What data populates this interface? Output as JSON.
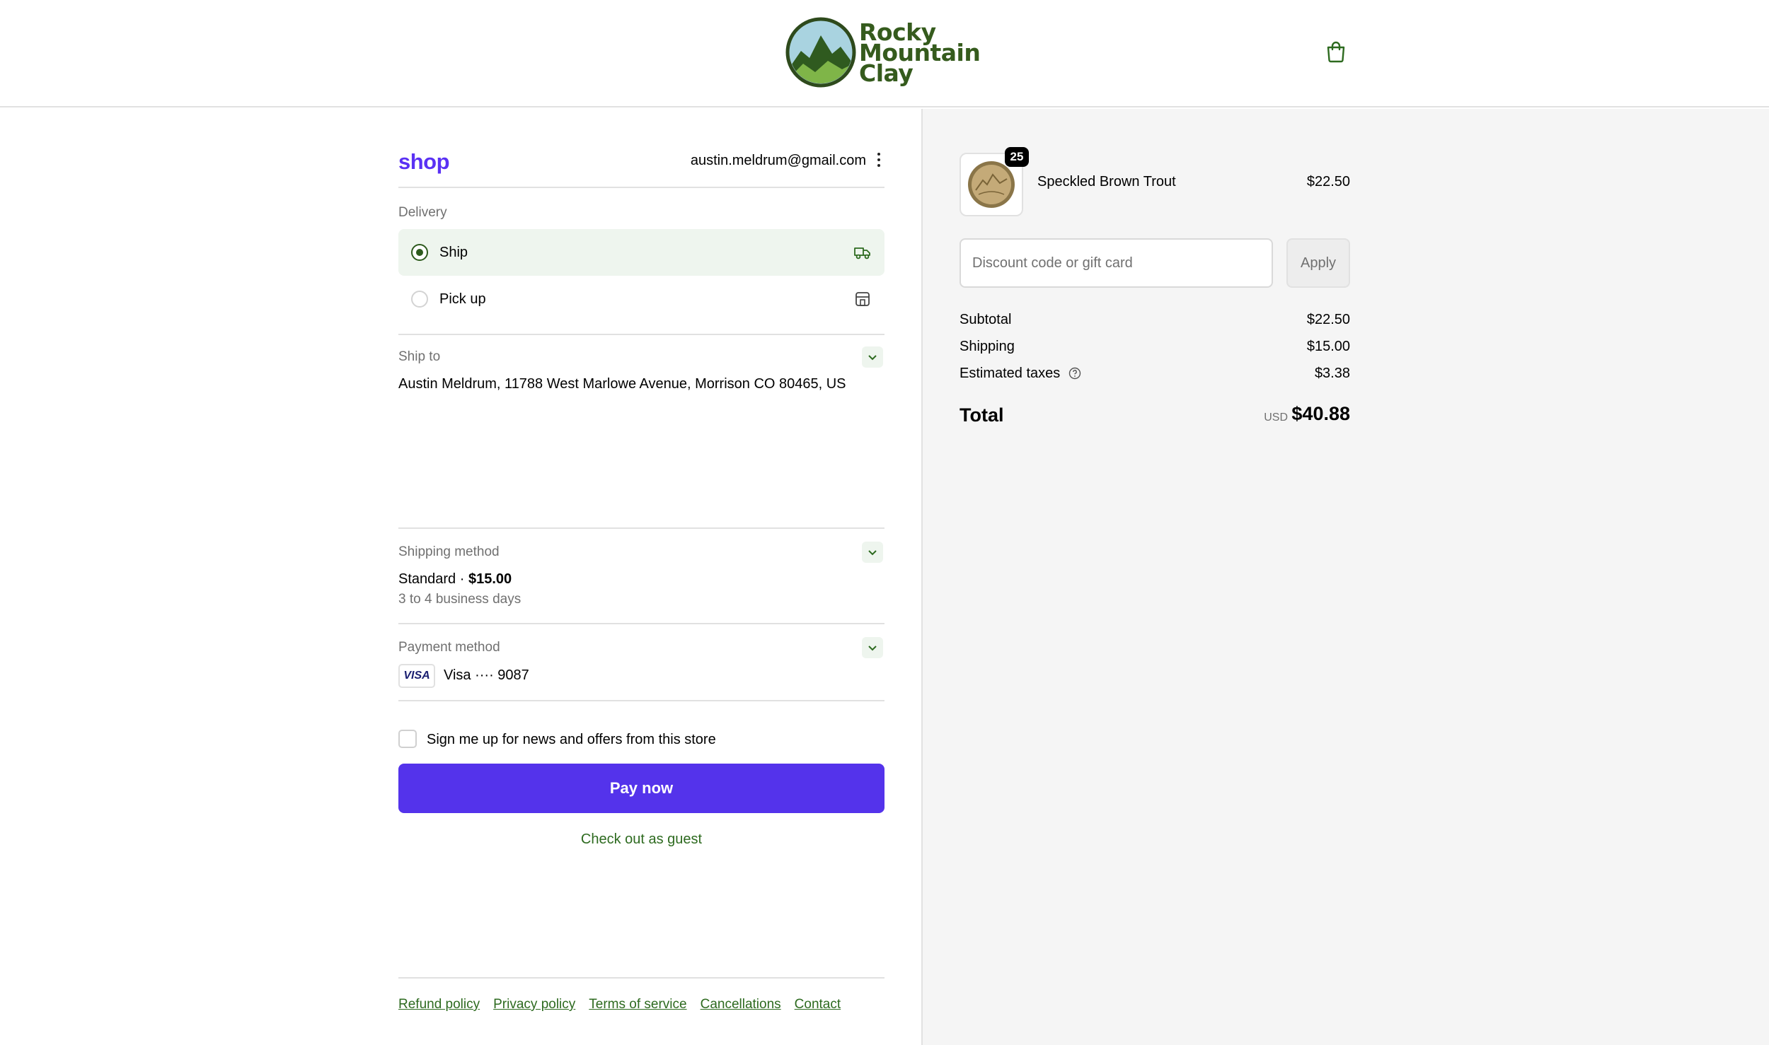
{
  "header": {
    "logo_lines": [
      "Rocky",
      "Mountain",
      "Clay"
    ],
    "cart_icon": "shopping-bag-icon"
  },
  "account": {
    "shop_logo": "shop",
    "email": "austin.meldrum@gmail.com"
  },
  "delivery": {
    "label": "Delivery",
    "options": [
      {
        "label": "Ship",
        "selected": true,
        "icon": "truck-icon"
      },
      {
        "label": "Pick up",
        "selected": false,
        "icon": "store-icon"
      }
    ]
  },
  "ship_to": {
    "label": "Ship to",
    "address": "Austin Meldrum, 11788 West Marlowe Avenue, Morrison CO 80465, US"
  },
  "shipping_method": {
    "label": "Shipping method",
    "name": "Standard · ",
    "price": "$15.00",
    "eta": "3 to 4 business days"
  },
  "payment_method": {
    "label": "Payment method",
    "brand_badge": "VISA",
    "card": "Visa ···· 9087"
  },
  "newsletter": {
    "label": "Sign me up for news and offers from this store",
    "checked": false
  },
  "pay_button": "Pay now",
  "guest_link": "Check out as guest",
  "footer_links": [
    "Refund policy",
    "Privacy policy",
    "Terms of service",
    "Cancellations",
    "Contact"
  ],
  "order": {
    "item": {
      "name": "Speckled Brown Trout",
      "price": "$22.50",
      "quantity": "25"
    },
    "discount": {
      "placeholder": "Discount code or gift card",
      "apply_label": "Apply"
    },
    "subtotal": {
      "label": "Subtotal",
      "value": "$22.50"
    },
    "shipping": {
      "label": "Shipping",
      "value": "$15.00"
    },
    "taxes": {
      "label": "Estimated taxes",
      "value": "$3.38"
    },
    "total": {
      "label": "Total",
      "currency": "USD",
      "value": "$40.88"
    }
  },
  "colors": {
    "accent_purple": "#5433eb",
    "brand_green": "#355b1d",
    "link_green": "#2d6a1f"
  }
}
